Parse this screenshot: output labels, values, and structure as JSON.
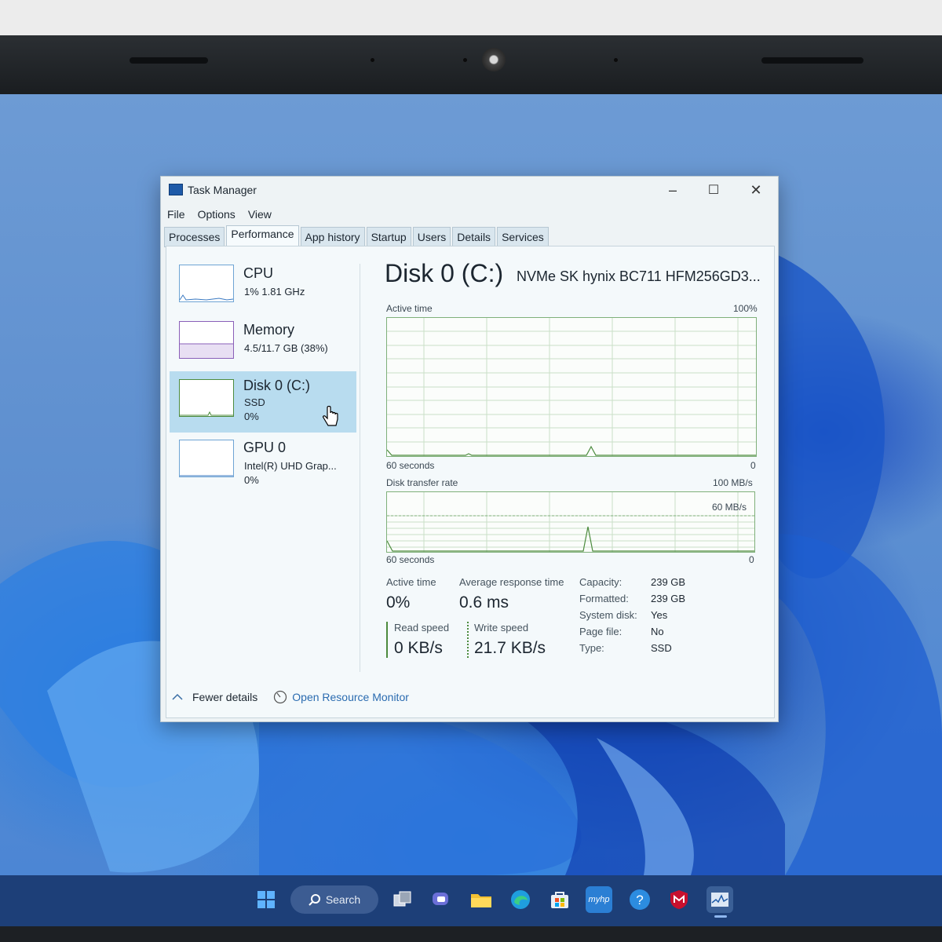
{
  "taskbar": {
    "search_label": "Search",
    "items": [
      "start-icon",
      "search",
      "task-view-icon",
      "teams-chat-icon",
      "file-explorer-icon",
      "edge-icon",
      "store-icon",
      "myhp-icon",
      "help-icon",
      "mcafee-icon",
      "task-manager-icon"
    ],
    "myhp_text": "myhp"
  },
  "window": {
    "title": "Task Manager",
    "controls": {
      "minimize": "–",
      "maximize": "☐",
      "close": "✕"
    },
    "menu": [
      "File",
      "Options",
      "View"
    ],
    "tabs": [
      "Processes",
      "Performance",
      "App history",
      "Startup",
      "Users",
      "Details",
      "Services"
    ],
    "active_tab": "Performance"
  },
  "sidebar": {
    "items": [
      {
        "name": "CPU",
        "sub1": "1% 1.81 GHz",
        "sub2": ""
      },
      {
        "name": "Memory",
        "sub1": "4.5/11.7 GB (38%)",
        "sub2": ""
      },
      {
        "name": "Disk 0 (C:)",
        "sub1": "SSD",
        "sub2": "0%"
      },
      {
        "name": "GPU 0",
        "sub1": "Intel(R) UHD Grap...",
        "sub2": "0%"
      }
    ],
    "selected_index": 2
  },
  "detail": {
    "title": "Disk 0 (C:)",
    "model": "NVMe SK hynix BC711 HFM256GD3...",
    "graph1": {
      "label": "Active time",
      "max": "100%",
      "time": "60 seconds",
      "min": "0"
    },
    "graph2": {
      "label": "Disk transfer rate",
      "max": "100 MB/s",
      "mid": "60 MB/s",
      "time": "60 seconds",
      "min": "0"
    },
    "stats": {
      "active_time_label": "Active time",
      "active_time_value": "0%",
      "avg_response_label": "Average response time",
      "avg_response_value": "0.6 ms",
      "read_label": "Read speed",
      "read_value": "0 KB/s",
      "write_label": "Write speed",
      "write_value": "21.7 KB/s"
    },
    "properties": [
      {
        "key": "Capacity:",
        "value": "239 GB"
      },
      {
        "key": "Formatted:",
        "value": "239 GB"
      },
      {
        "key": "System disk:",
        "value": "Yes"
      },
      {
        "key": "Page file:",
        "value": "No"
      },
      {
        "key": "Type:",
        "value": "SSD"
      }
    ]
  },
  "footer": {
    "fewer_details": "Fewer details",
    "open_resource_monitor": "Open Resource Monitor"
  },
  "colors": {
    "disk_line": "#4c8b3e",
    "selected_bg": "#b8dcef",
    "link": "#2a6bb0",
    "taskbar": "#1d3f78"
  }
}
